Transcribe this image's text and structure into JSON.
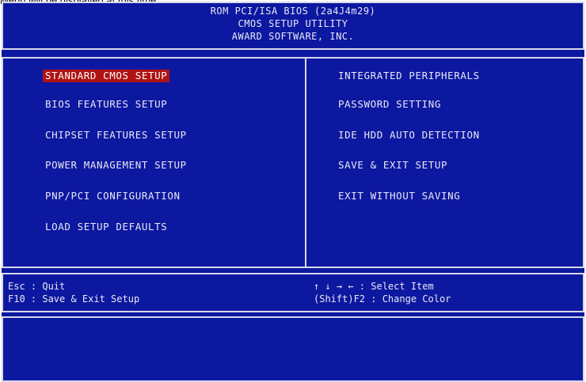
{
  "caption": "Menu will be displayed at this time.",
  "header": {
    "line1": "ROM PCI/ISA BIOS (2a4J4m29)",
    "line2": "CMOS SETUP UTILITY",
    "line3": "AWARD SOFTWARE, INC."
  },
  "menu": {
    "left": [
      "STANDARD CMOS SETUP",
      "BIOS FEATURES SETUP",
      "CHIPSET FEATURES SETUP",
      "POWER MANAGEMENT SETUP",
      "PNP/PCI CONFIGURATION",
      "LOAD SETUP DEFAULTS"
    ],
    "right": [
      "INTEGRATED PERIPHERALS",
      "PASSWORD SETTING",
      "IDE HDD AUTO DETECTION",
      "SAVE & EXIT SETUP",
      "EXIT WITHOUT SAVING"
    ],
    "selected": "STANDARD CMOS SETUP"
  },
  "help": {
    "esc": "Esc : Quit",
    "f10": "F10 : Save & Exit Setup",
    "arrows": "↑ ↓ → ←   : Select Item",
    "shift_f2": "(Shift)F2 : Change Color"
  },
  "colors": {
    "background": "#0d18a0",
    "text": "#e8e8f4",
    "highlight": "#b01212"
  }
}
